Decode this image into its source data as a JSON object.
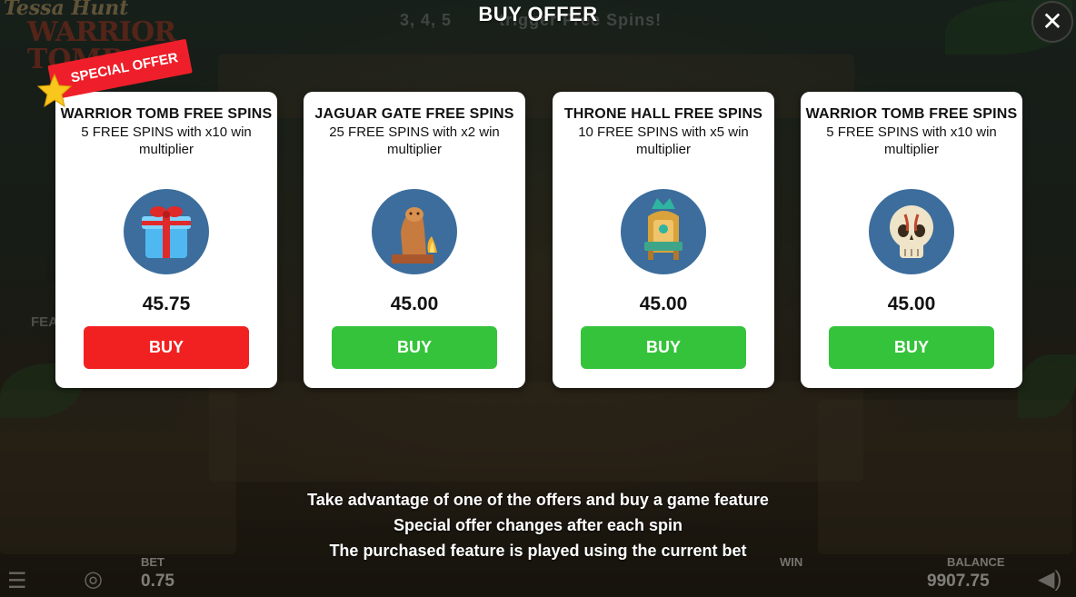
{
  "header": {
    "title": "BUY OFFER",
    "close_icon": "close-icon"
  },
  "background": {
    "logo_line1": "Tessa Hunt",
    "logo_line2": "WARRIOR",
    "logo_line3": "TOMB",
    "hint": "3, 4, 5",
    "hint_tail": "trigger Free Spins!",
    "side_text": "FEA"
  },
  "special_badge": "SPECIAL OFFER",
  "offers": [
    {
      "name": "WARRIOR TOMB FREE SPINS",
      "description": "5 FREE SPINS with x10 win multiplier",
      "icon": "gift-icon",
      "price": "45.75",
      "buy_label": "BUY",
      "button_color": "#f22121"
    },
    {
      "name": "JAGUAR GATE FREE SPINS",
      "description": "25 FREE SPINS with x2 win multiplier",
      "icon": "jaguar-statue-icon",
      "price": "45.00",
      "buy_label": "BUY",
      "button_color": "#35c33b"
    },
    {
      "name": "THRONE HALL FREE SPINS",
      "description": "10 FREE SPINS with x5 win multiplier",
      "icon": "throne-icon",
      "price": "45.00",
      "buy_label": "BUY",
      "button_color": "#35c33b"
    },
    {
      "name": "WARRIOR TOMB FREE SPINS",
      "description": "5 FREE SPINS with x10 win multiplier",
      "icon": "skull-icon",
      "price": "45.00",
      "buy_label": "BUY",
      "button_color": "#35c33b"
    }
  ],
  "info_lines": [
    "Take advantage of one of the offers and buy a game feature",
    "Special offer changes after each spin",
    "The purchased feature is played using the current bet"
  ],
  "bottom_bar": {
    "bet_label": "BET",
    "bet_value": "0.75",
    "win_label": "WIN",
    "balance_label": "BALANCE",
    "balance_value": "9907.75"
  },
  "colors": {
    "accent_green": "#35c33b",
    "accent_red": "#f22121",
    "icon_bg": "#3c6d9c"
  }
}
